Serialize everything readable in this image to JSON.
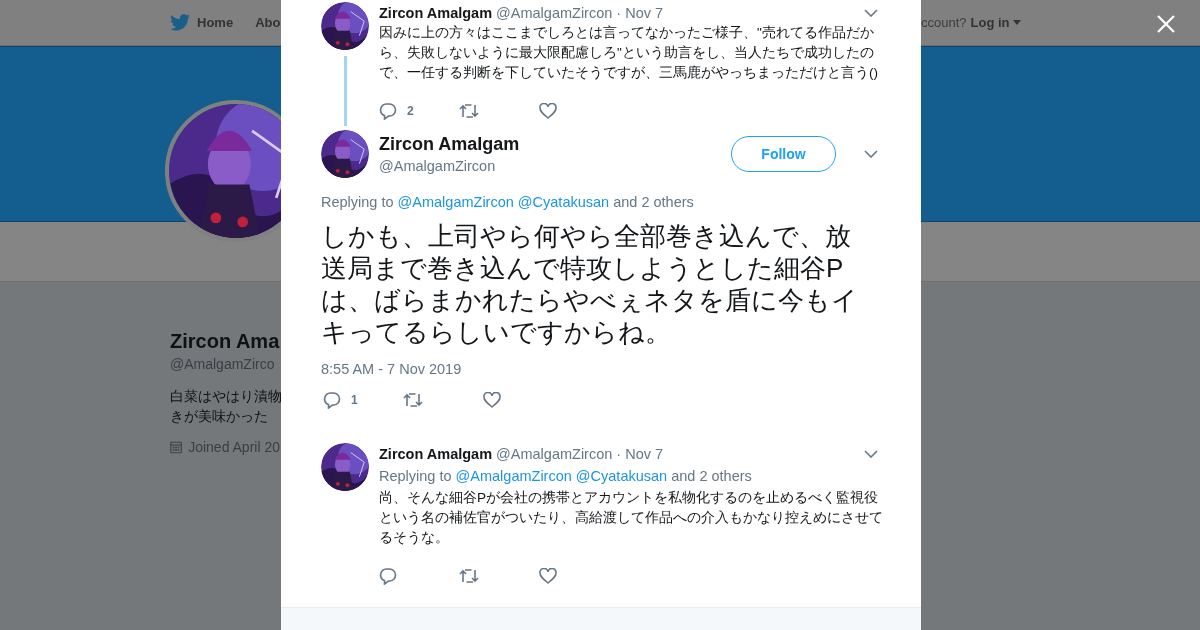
{
  "background": {
    "nav": {
      "home": "Home",
      "about": "Abo",
      "account": "ccount?",
      "login": "Log in"
    },
    "profile": {
      "name": "Zircon Ama",
      "handle": "@AmalgamZirco",
      "bio": [
        "白菜はやはり漬物",
        "きが美味かった"
      ],
      "joined": "Joined April 20"
    }
  },
  "tweets": [
    {
      "kind": "thread",
      "name": "Zircon Amalgam",
      "handle": "@AmalgamZircon",
      "date": "· Nov 7",
      "text": "因みに上の方々はここまでしろとは言ってなかったご様子、\"売れてる作品だから、失敗しないように最大限配慮しろ\"という助言をし、当人たちで成功したので、一任する判断を下していたそうですが、三馬鹿がやっちまっただけと言う()",
      "replies": "2"
    },
    {
      "kind": "focused",
      "name": "Zircon Amalgam",
      "handle": "@AmalgamZircon",
      "follow": "Follow",
      "replying": {
        "prefix": "Replying to",
        "mentions": [
          "@AmalgamZircon",
          "@Cyatakusan"
        ],
        "suffix": "and 2 others"
      },
      "text": "しかも、上司やら何やら全部巻き込んで、放送局まで巻き込んで特攻しようとした細谷Pは、ばらまかれたらやべぇネタを盾に今もイキってるらしいですからね。",
      "time": "8:55 AM - 7 Nov 2019",
      "replies": "1"
    },
    {
      "kind": "reply",
      "name": "Zircon Amalgam",
      "handle": "@AmalgamZircon",
      "date": "· Nov 7",
      "replying": {
        "prefix": "Replying to",
        "mentions": [
          "@AmalgamZircon",
          "@Cyatakusan"
        ],
        "suffix": "and 2 others"
      },
      "text": "尚、そんな細谷Pが会社の携帯とアカウントを私物化するのを止めるべく監視役という名の補佐官がついたり、高給渡して作品への介入もかなり控えめにさせてるそうな。"
    }
  ]
}
